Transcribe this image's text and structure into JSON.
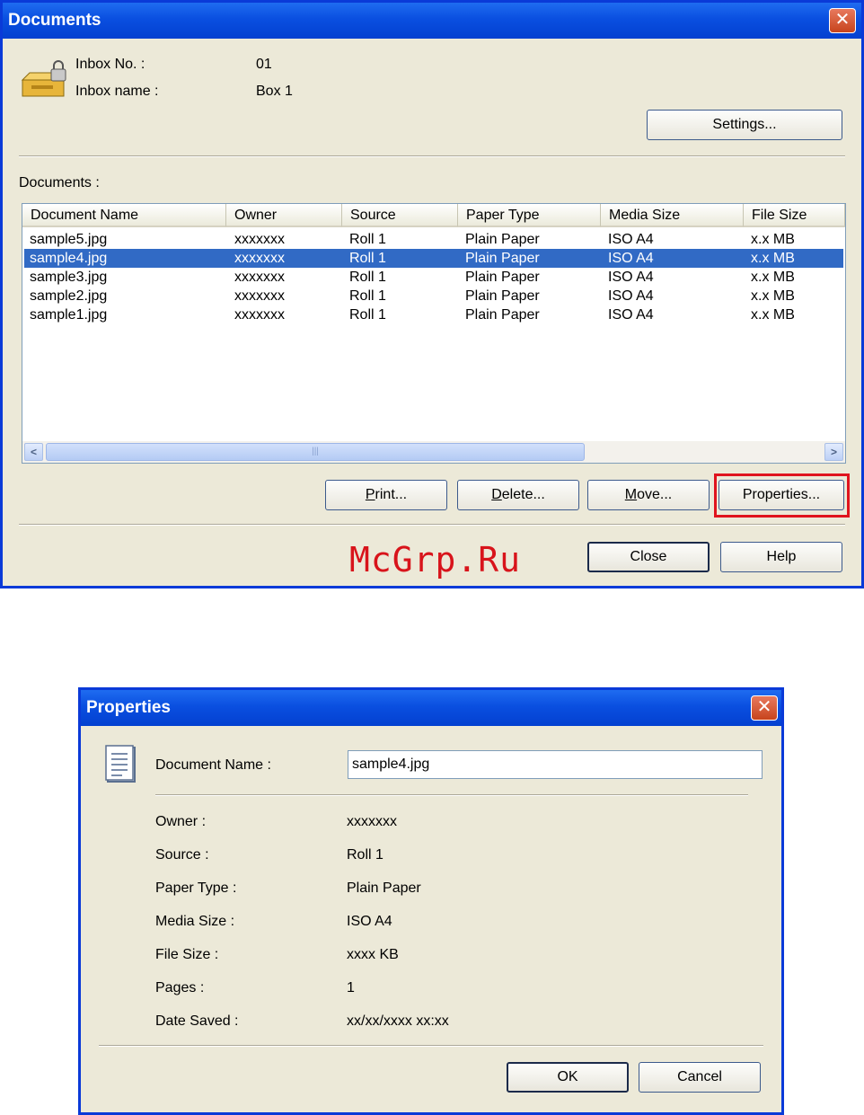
{
  "documents_window": {
    "title": "Documents",
    "inbox_no_label": "Inbox No. :",
    "inbox_no_value": "01",
    "inbox_name_label": "Inbox name :",
    "inbox_name_value": "Box 1",
    "settings_button": "Settings...",
    "documents_label": "Documents :",
    "columns": [
      "Document Name",
      "Owner",
      "Source",
      "Paper Type",
      "Media Size",
      "File Size"
    ],
    "rows": [
      [
        "sample5.jpg",
        "xxxxxxx",
        "Roll 1",
        "Plain Paper",
        "ISO A4",
        "x.x MB"
      ],
      [
        "sample4.jpg",
        "xxxxxxx",
        "Roll 1",
        "Plain Paper",
        "ISO A4",
        "x.x MB"
      ],
      [
        "sample3.jpg",
        "xxxxxxx",
        "Roll 1",
        "Plain Paper",
        "ISO A4",
        "x.x MB"
      ],
      [
        "sample2.jpg",
        "xxxxxxx",
        "Roll 1",
        "Plain Paper",
        "ISO A4",
        "x.x MB"
      ],
      [
        "sample1.jpg",
        "xxxxxxx",
        "Roll 1",
        "Plain Paper",
        "ISO A4",
        "x.x MB"
      ]
    ],
    "selected_row": 1,
    "print_button": "Print...",
    "delete_button": "Delete...",
    "move_button": "Move...",
    "properties_button": "Properties...",
    "close_button": "Close",
    "help_button": "Help"
  },
  "watermark": "McGrp.Ru",
  "properties_window": {
    "title": "Properties",
    "document_name_label": "Document Name :",
    "document_name_value": "sample4.jpg",
    "owner_label": "Owner :",
    "owner_value": "xxxxxxx",
    "source_label": "Source :",
    "source_value": "Roll 1",
    "paper_type_label": "Paper Type :",
    "paper_type_value": "Plain Paper",
    "media_size_label": "Media Size :",
    "media_size_value": "ISO A4",
    "file_size_label": "File Size :",
    "file_size_value": "xxxx KB",
    "pages_label": "Pages :",
    "pages_value": "1",
    "date_saved_label": "Date Saved :",
    "date_saved_value": "xx/xx/xxxx xx:xx",
    "ok_button": "OK",
    "cancel_button": "Cancel"
  },
  "colors": {
    "title_bar": "#0a4fe0",
    "selection": "#316ac5",
    "highlight": "#e0141e",
    "watermark": "#d8141b"
  },
  "icons": {
    "inbox": "locked-inbox-icon",
    "document": "document-icon",
    "close": "close-icon"
  }
}
